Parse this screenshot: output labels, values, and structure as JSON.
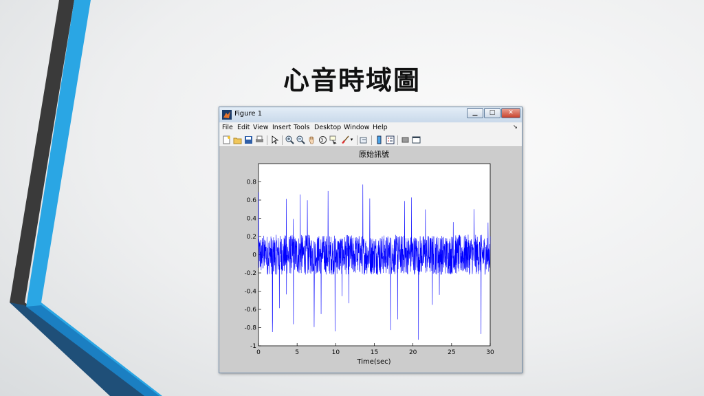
{
  "slide": {
    "title": "心音時域圖"
  },
  "window": {
    "title": "Figure 1",
    "app_icon": "matlab-icon",
    "buttons": {
      "minimize": "▁",
      "maximize": "□",
      "close": "✕"
    }
  },
  "menu": {
    "items": [
      "File",
      "Edit",
      "View",
      "Insert",
      "Tools",
      "Desktop",
      "Window",
      "Help"
    ],
    "overflow": "➘"
  },
  "toolbar": {
    "icons": [
      "new-figure-icon",
      "open-file-icon",
      "save-icon",
      "print-icon",
      "pointer-icon",
      "zoom-in-icon",
      "zoom-out-icon",
      "pan-icon",
      "rotate-3d-icon",
      "data-cursor-icon",
      "brush-icon",
      "link-plot-icon",
      "colorbar-icon",
      "legend-icon",
      "hide-plot-tools-icon",
      "show-plot-tools-icon"
    ]
  },
  "chart_data": {
    "type": "line",
    "title": "原始訊號",
    "xlabel": "Time(sec)",
    "ylabel": "",
    "xlim": [
      0,
      30
    ],
    "ylim": [
      -1,
      1
    ],
    "x_ticks": [
      0,
      5,
      10,
      15,
      20,
      25,
      30
    ],
    "y_ticks": [
      -1,
      -0.8,
      -0.6,
      -0.4,
      -0.2,
      0,
      0.2,
      0.4,
      0.6,
      0.8
    ],
    "y_tick_labels": [
      "-1",
      "-0.8",
      "-0.6",
      "-0.4",
      "-0.2",
      "0",
      "0.2",
      "0.4",
      "0.6",
      "0.8"
    ],
    "line_color": "#0000ff",
    "noise_amplitude": 0.22,
    "beat_period": 0.9,
    "beat_peak_max": 0.85,
    "beat_trough_min": -0.98,
    "grid": false
  },
  "colors": {
    "deco_blue": "#2aa6e4",
    "deco_dark": "#3c3c3c",
    "figure_bg": "#cccccc",
    "axes_bg": "#ffffff"
  }
}
